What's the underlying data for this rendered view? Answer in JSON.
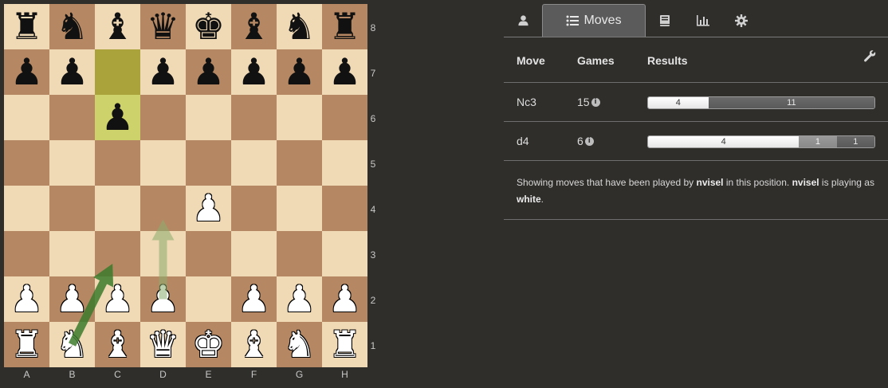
{
  "board": {
    "ranks": [
      "8",
      "7",
      "6",
      "5",
      "4",
      "3",
      "2",
      "1"
    ],
    "files": [
      "A",
      "B",
      "C",
      "D",
      "E",
      "F",
      "G",
      "H"
    ],
    "position": [
      [
        "bR",
        "bN",
        "bB",
        "bQ",
        "bK",
        "bB",
        "bN",
        "bR"
      ],
      [
        "bP",
        "bP",
        "",
        "bP",
        "bP",
        "bP",
        "bP",
        "bP"
      ],
      [
        "",
        "",
        "bP",
        "",
        "",
        "",
        "",
        ""
      ],
      [
        "",
        "",
        "",
        "",
        "",
        "",
        "",
        ""
      ],
      [
        "",
        "",
        "",
        "",
        "wP",
        "",
        "",
        ""
      ],
      [
        "",
        "",
        "",
        "",
        "",
        "",
        "",
        ""
      ],
      [
        "wP",
        "wP",
        "wP",
        "wP",
        "",
        "wP",
        "wP",
        "wP"
      ],
      [
        "wR",
        "wN",
        "wB",
        "wQ",
        "wK",
        "wB",
        "wN",
        "wR"
      ]
    ],
    "last_move": {
      "from": "c7",
      "to": "c6"
    },
    "arrows": [
      {
        "from": "b1",
        "to": "c3",
        "color": "#3d7a2c",
        "opacity": 0.85
      },
      {
        "from": "d2",
        "to": "d4",
        "color": "#8aad6e",
        "opacity": 0.55
      }
    ]
  },
  "tabs": [
    {
      "id": "player",
      "icon": "user-icon",
      "label": ""
    },
    {
      "id": "moves",
      "icon": "list-icon",
      "label": "Moves",
      "active": true
    },
    {
      "id": "openings",
      "icon": "book-icon",
      "label": ""
    },
    {
      "id": "stats",
      "icon": "bar-chart-icon",
      "label": ""
    },
    {
      "id": "settings",
      "icon": "gear-icon",
      "label": ""
    }
  ],
  "table": {
    "headers": {
      "move": "Move",
      "games": "Games",
      "results": "Results"
    },
    "rows": [
      {
        "move": "Nc3",
        "games": "15",
        "white": 4,
        "draw": 0,
        "black": 11,
        "white_label": "4",
        "draw_label": "",
        "black_label": "11"
      },
      {
        "move": "d4",
        "games": "6",
        "white": 4,
        "draw": 1,
        "black": 1,
        "white_label": "4",
        "draw_label": "1",
        "black_label": "1"
      }
    ]
  },
  "explanation": {
    "part1": "Showing moves that have been played by ",
    "player": "nvisel",
    "part2": " in this position. ",
    "player2": "nvisel",
    "part3": " is playing as ",
    "color": "white",
    "part4": "."
  },
  "colors": {
    "background": "#302e2b",
    "light_square": "#f0d9b5",
    "dark_square": "#b58863",
    "highlight_from": "#aaa23a",
    "highlight_to": "#cdd26a"
  }
}
